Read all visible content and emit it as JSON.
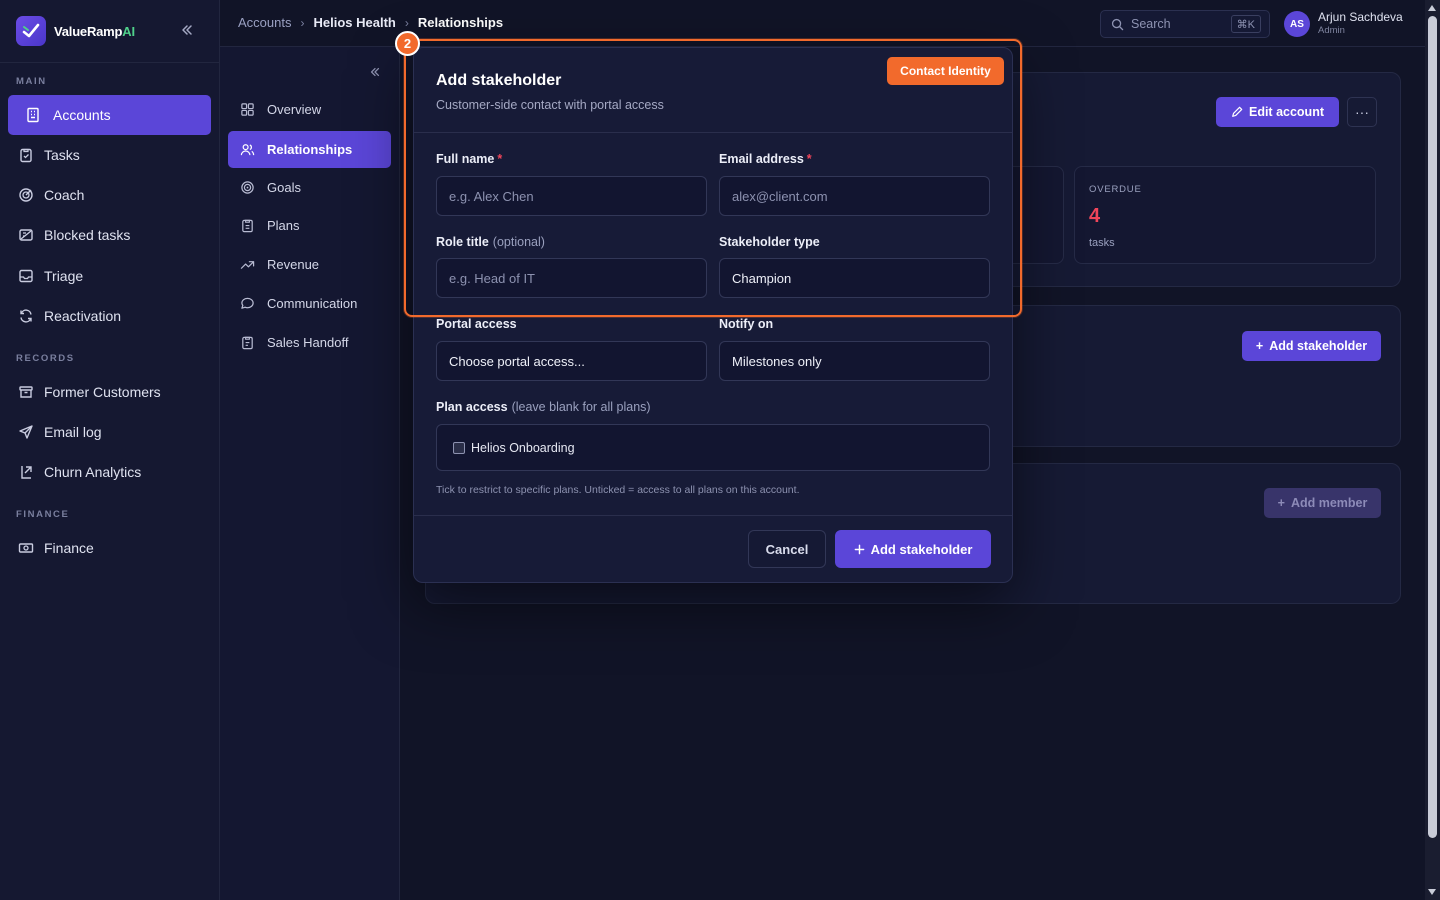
{
  "brand": {
    "name": "ValueRamp",
    "name_accent": "AI"
  },
  "sidebar": {
    "sections": {
      "main": "MAIN",
      "records": "RECORDS",
      "finance": "FINANCE"
    },
    "items": [
      {
        "label": "Accounts",
        "icon": "building-icon",
        "active": true
      },
      {
        "label": "Tasks",
        "icon": "clipboard-icon"
      },
      {
        "label": "Coach",
        "icon": "target-icon"
      },
      {
        "label": "Blocked tasks",
        "icon": "blocked-icon"
      },
      {
        "label": "Triage",
        "icon": "inbox-icon"
      },
      {
        "label": "Reactivation",
        "icon": "refresh-icon"
      },
      {
        "label": "Former Customers",
        "icon": "archive-icon"
      },
      {
        "label": "Email log",
        "icon": "send-icon"
      },
      {
        "label": "Churn Analytics",
        "icon": "analytics-icon"
      },
      {
        "label": "Finance",
        "icon": "money-icon"
      }
    ]
  },
  "subnav": {
    "items": [
      {
        "label": "Overview",
        "icon": "grid-icon"
      },
      {
        "label": "Relationships",
        "icon": "users-icon",
        "active": true
      },
      {
        "label": "Goals",
        "icon": "target-icon"
      },
      {
        "label": "Plans",
        "icon": "clipboard-icon"
      },
      {
        "label": "Revenue",
        "icon": "trend-icon"
      },
      {
        "label": "Communication",
        "icon": "chat-icon"
      },
      {
        "label": "Sales Handoff",
        "icon": "clipboard-check-icon"
      }
    ]
  },
  "header": {
    "breadcrumb": [
      "Accounts",
      "Helios Health",
      "Relationships"
    ],
    "search_placeholder": "Search",
    "search_shortcut": "⌘K",
    "user": {
      "initials": "AS",
      "name": "Arjun Sachdeva",
      "role": "Admin"
    }
  },
  "main": {
    "edit_account": "Edit account",
    "more": "···",
    "overdue": {
      "label": "OVERDUE",
      "value": "4",
      "sub": "tasks"
    },
    "add_stakeholder": "Add stakeholder",
    "add_member": "Add member"
  },
  "modal": {
    "title": "Add stakeholder",
    "subtitle": "Customer-side contact with portal access",
    "full_name": {
      "label": "Full name",
      "required": "*",
      "placeholder": "e.g. Alex Chen"
    },
    "email": {
      "label": "Email address",
      "required": "*",
      "placeholder": "alex@client.com"
    },
    "role_title": {
      "label": "Role title",
      "optional": "(optional)",
      "placeholder": "e.g. Head of IT"
    },
    "stakeholder_type": {
      "label": "Stakeholder type",
      "value": "Champion"
    },
    "portal_access": {
      "label": "Portal access",
      "value": "Choose portal access..."
    },
    "notify_on": {
      "label": "Notify on",
      "value": "Milestones only"
    },
    "plan_access": {
      "label": "Plan access",
      "hint": "(leave blank for all plans)",
      "option": "Helios Onboarding",
      "checked": false
    },
    "helper": "Tick to restrict to specific plans. Unticked = access to all plans on this account.",
    "cancel": "Cancel",
    "submit": "Add stakeholder"
  },
  "annotation": {
    "step": "2",
    "tag": "Contact Identity"
  },
  "colors": {
    "accent": "#5b46d8",
    "highlight": "#f26a2c",
    "danger": "#f0455a",
    "brand_ai": "#4fd08a"
  }
}
